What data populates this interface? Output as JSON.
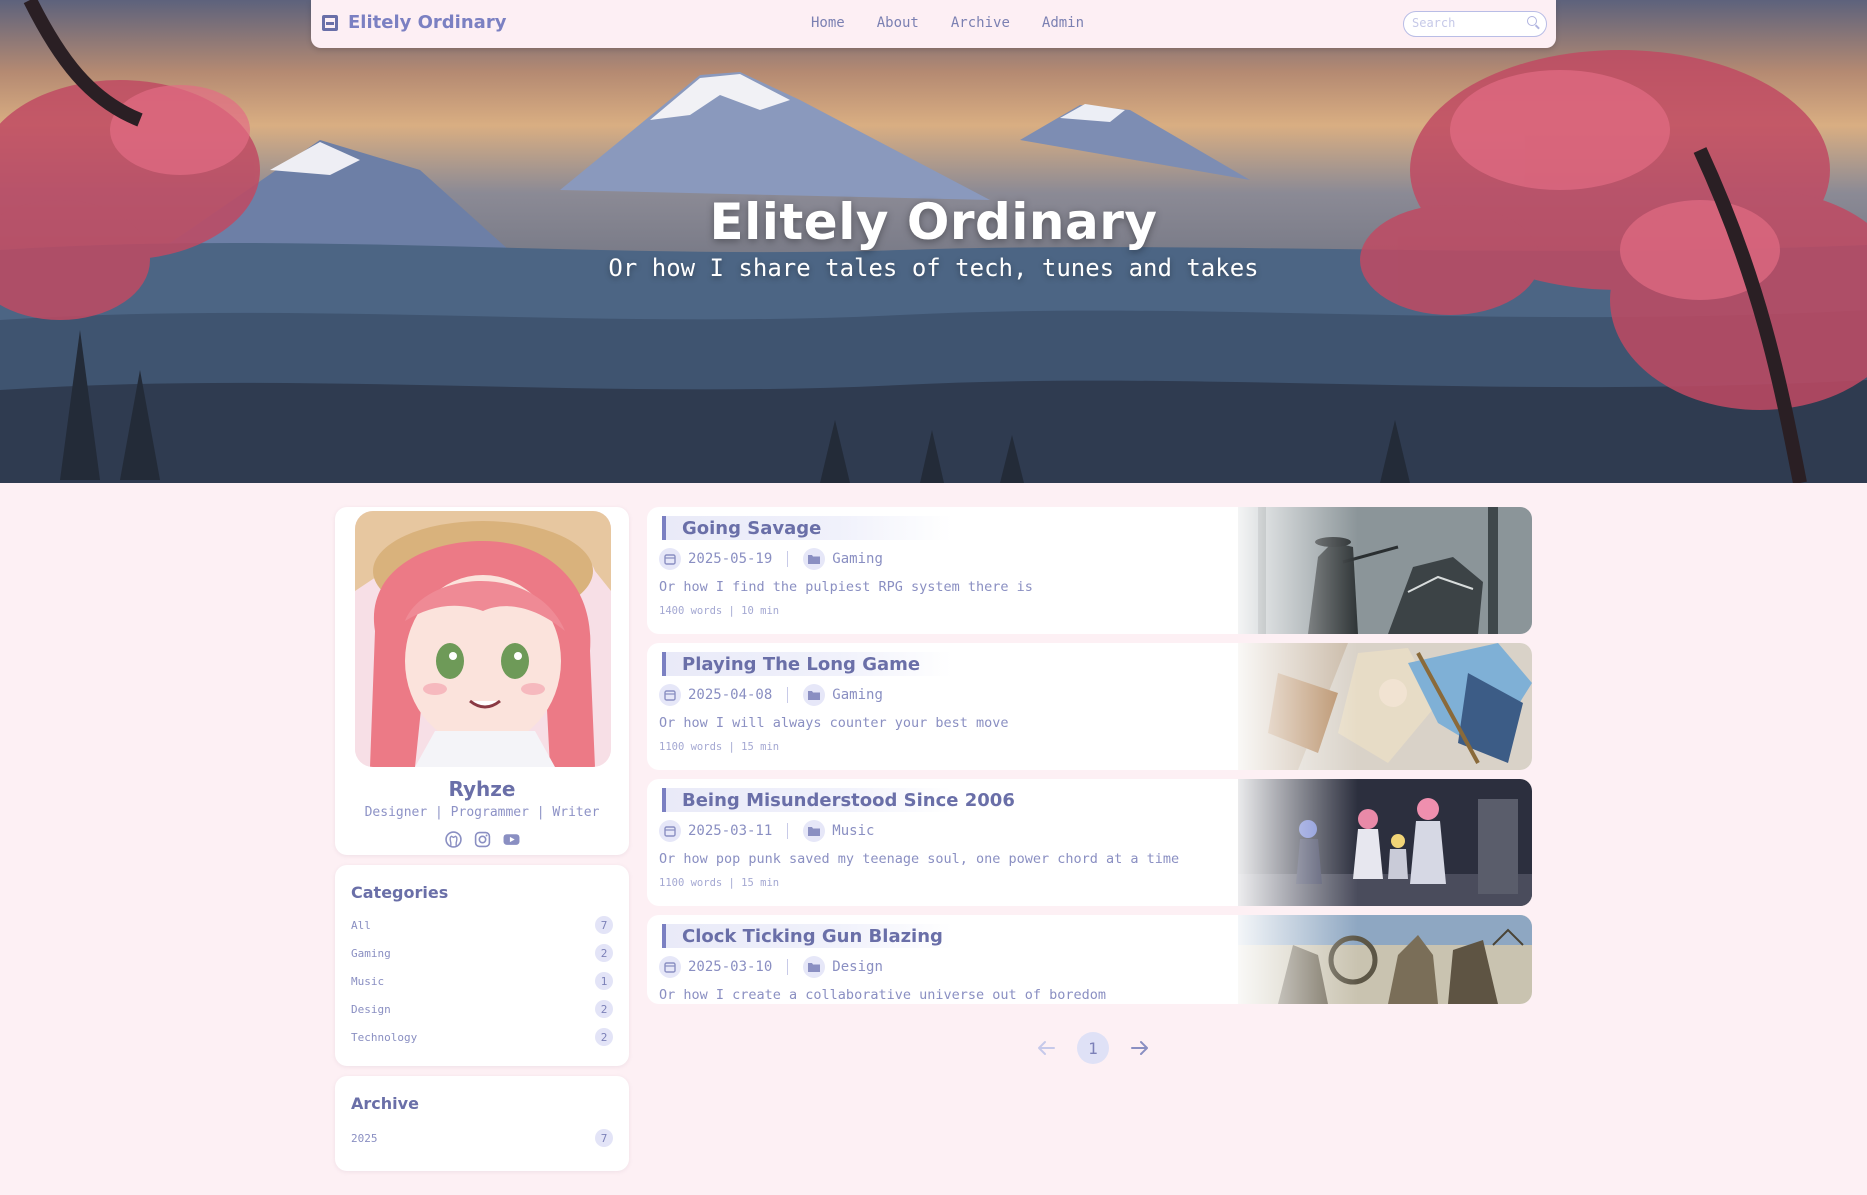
{
  "brand": {
    "name": "Elitely Ordinary",
    "icon": "book-icon"
  },
  "nav": {
    "links": [
      "Home",
      "About",
      "Archive",
      "Admin"
    ]
  },
  "search": {
    "placeholder": "Search",
    "icon": "search-icon"
  },
  "hero": {
    "title": "Elitely Ordinary",
    "subtitle": "Or how I share tales of tech, tunes and takes"
  },
  "profile": {
    "name": "Ryhze",
    "role": "Designer | Programmer | Writer",
    "socials": [
      "github-icon",
      "instagram-icon",
      "youtube-icon"
    ]
  },
  "categories": {
    "title": "Categories",
    "items": [
      {
        "label": "All",
        "count": "7"
      },
      {
        "label": "Gaming",
        "count": "2"
      },
      {
        "label": "Music",
        "count": "1"
      },
      {
        "label": "Design",
        "count": "2"
      },
      {
        "label": "Technology",
        "count": "2"
      }
    ]
  },
  "archive": {
    "title": "Archive",
    "items": [
      {
        "label": "2025",
        "count": "7"
      }
    ]
  },
  "posts": [
    {
      "title": "Going Savage",
      "date": "2025-05-19",
      "category": "Gaming",
      "excerpt": "Or how I find the pulpiest RPG system there is",
      "stats": "1400 words | 10 min"
    },
    {
      "title": "Playing The Long Game",
      "date": "2025-04-08",
      "category": "Gaming",
      "excerpt": "Or how I will always counter your best move",
      "stats": "1100 words | 15 min"
    },
    {
      "title": "Being Misunderstood Since 2006",
      "date": "2025-03-11",
      "category": "Music",
      "excerpt": "Or how pop punk saved my teenage soul, one power chord at a time",
      "stats": "1100 words | 15 min"
    },
    {
      "title": "Clock Ticking Gun Blazing",
      "date": "2025-03-10",
      "category": "Design",
      "excerpt": "Or how I create a collaborative universe out of boredom",
      "stats": ""
    }
  ],
  "pagination": {
    "current": "1"
  },
  "colors": {
    "accent": "#6a6fa8",
    "background": "#fdf0f4",
    "card": "#ffffff"
  }
}
